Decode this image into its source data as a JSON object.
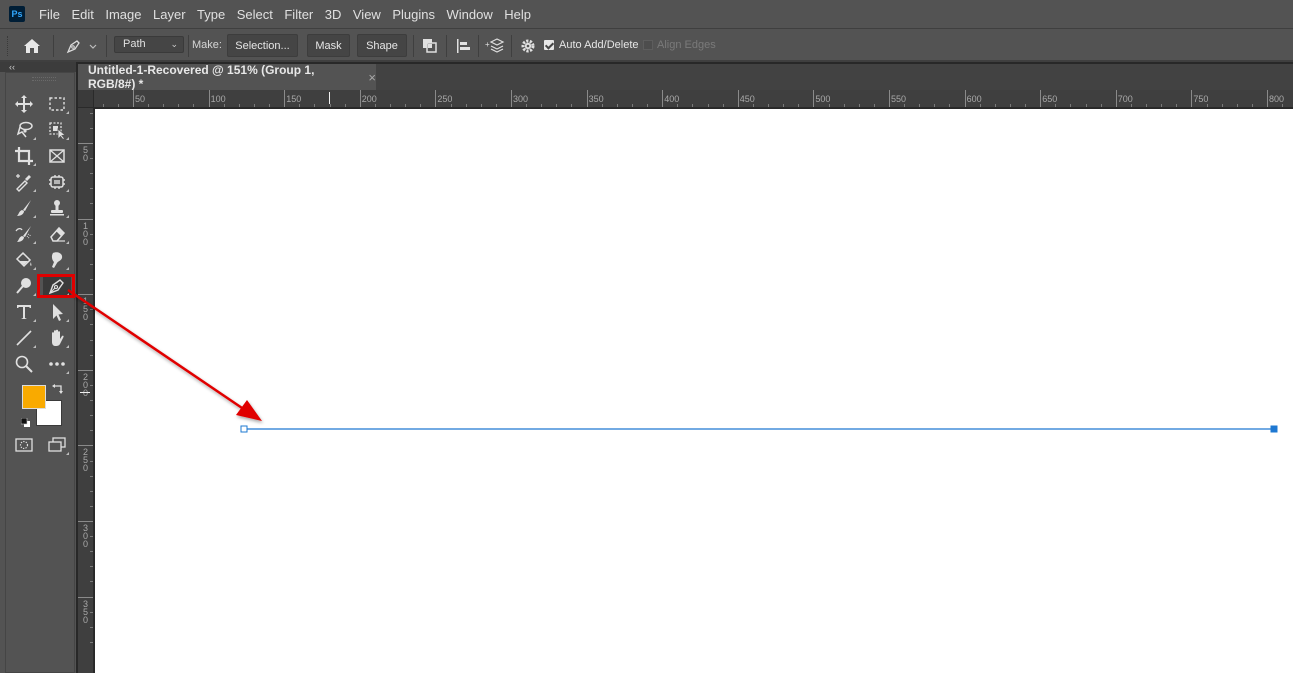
{
  "app": {
    "logo": "Ps",
    "menu": [
      "File",
      "Edit",
      "Image",
      "Layer",
      "Type",
      "Select",
      "Filter",
      "3D",
      "View",
      "Plugins",
      "Window",
      "Help"
    ]
  },
  "options_bar": {
    "mode_select": "Path",
    "make_label": "Make:",
    "buttons": {
      "selection": "Selection...",
      "mask": "Mask",
      "shape": "Shape"
    },
    "auto_add_delete": {
      "label": "Auto Add/Delete",
      "checked": true
    },
    "align_edges": {
      "label": "Align Edges",
      "checked": false,
      "enabled": false
    }
  },
  "toolbox": {
    "collapse_glyph": "‹‹",
    "tools": [
      {
        "name": "move-tool",
        "icon": "move-icon"
      },
      {
        "name": "rectangular-marquee-tool",
        "icon": "marquee-icon"
      },
      {
        "name": "lasso-tool",
        "icon": "lasso-icon"
      },
      {
        "name": "object-selection-tool",
        "icon": "object-selection-icon"
      },
      {
        "name": "crop-tool",
        "icon": "crop-icon"
      },
      {
        "name": "frame-tool",
        "icon": "frame-icon"
      },
      {
        "name": "eyedropper-tool",
        "icon": "eyedropper-icon"
      },
      {
        "name": "spot-healing-tool",
        "icon": "healing-icon"
      },
      {
        "name": "brush-tool",
        "icon": "brush-icon"
      },
      {
        "name": "clone-stamp-tool",
        "icon": "stamp-icon"
      },
      {
        "name": "history-brush-tool",
        "icon": "history-brush-icon"
      },
      {
        "name": "eraser-tool",
        "icon": "eraser-icon"
      },
      {
        "name": "paint-bucket-tool",
        "icon": "bucket-icon"
      },
      {
        "name": "smudge-tool",
        "icon": "smudge-icon"
      },
      {
        "name": "dodge-tool",
        "icon": "dodge-icon"
      },
      {
        "name": "pen-tool",
        "icon": "pen-icon",
        "active": true
      },
      {
        "name": "type-tool",
        "icon": "type-icon"
      },
      {
        "name": "path-selection-tool",
        "icon": "arrow-icon"
      },
      {
        "name": "line-tool",
        "icon": "line-icon"
      },
      {
        "name": "hand-tool",
        "icon": "hand-icon"
      },
      {
        "name": "zoom-tool",
        "icon": "zoom-icon"
      },
      {
        "name": "edit-toolbar",
        "icon": "more-icon"
      }
    ],
    "foreground_color": "#F9AA00",
    "background_color": "#FFFFFF"
  },
  "document": {
    "tab_title": "Untitled-1-Recovered @ 151% (Group 1, RGB/8#) *",
    "close_glyph": "×",
    "zoom_percent": 151
  },
  "rulers": {
    "top_labels": [
      "50",
      "100",
      "150",
      "200",
      "250",
      "300",
      "350",
      "400",
      "450",
      "500",
      "550",
      "600",
      "650",
      "700",
      "750",
      "800"
    ],
    "left_labels": [
      "50",
      "100",
      "150",
      "200",
      "250",
      "300",
      "350"
    ]
  },
  "annotation": {
    "highlight_color": "#E00000",
    "note": "Red box highlights Pen tool; arrow points to path start anchor"
  },
  "path": {
    "color": "#1E78D2"
  }
}
